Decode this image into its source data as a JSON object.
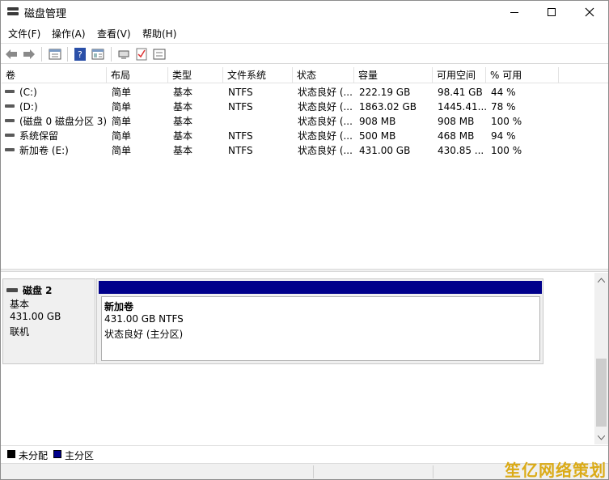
{
  "window": {
    "title": "磁盘管理"
  },
  "menu": [
    "文件(F)",
    "操作(A)",
    "查看(V)",
    "帮助(H)"
  ],
  "toolbar": [
    "back-arrow-icon",
    "forward-arrow-icon",
    "properties-icon",
    "help-icon",
    "list-view-icon",
    "connect-icon",
    "check-icon",
    "settings-icon"
  ],
  "columns": [
    "卷",
    "布局",
    "类型",
    "文件系统",
    "状态",
    "容量",
    "可用空间",
    "% 可用"
  ],
  "volumes": [
    {
      "name": "(C:)",
      "layout": "简单",
      "type": "基本",
      "fs": "NTFS",
      "status": "状态良好 (...",
      "capacity": "222.19 GB",
      "free": "98.41 GB",
      "pct": "44 %"
    },
    {
      "name": "(D:)",
      "layout": "简单",
      "type": "基本",
      "fs": "NTFS",
      "status": "状态良好 (...",
      "capacity": "1863.02 GB",
      "free": "1445.41...",
      "pct": "78 %"
    },
    {
      "name": "(磁盘 0 磁盘分区 3)",
      "layout": "简单",
      "type": "基本",
      "fs": "",
      "status": "状态良好 (...",
      "capacity": "908 MB",
      "free": "908 MB",
      "pct": "100 %"
    },
    {
      "name": "系统保留",
      "layout": "简单",
      "type": "基本",
      "fs": "NTFS",
      "status": "状态良好 (...",
      "capacity": "500 MB",
      "free": "468 MB",
      "pct": "94 %"
    },
    {
      "name": "新加卷 (E:)",
      "layout": "简单",
      "type": "基本",
      "fs": "NTFS",
      "status": "状态良好 (...",
      "capacity": "431.00 GB",
      "free": "430.85 ...",
      "pct": "100 %"
    }
  ],
  "disk": {
    "name": "磁盘 2",
    "kind": "基本",
    "size": "431.00 GB",
    "state": "联机",
    "partition": {
      "name": "新加卷",
      "size_fs": "431.00 GB NTFS",
      "status": "状态良好 (主分区)"
    }
  },
  "legend": [
    {
      "label": "未分配",
      "color": "#000000"
    },
    {
      "label": "主分区",
      "color": "#00008b"
    }
  ],
  "watermark": "笙亿网络策划"
}
